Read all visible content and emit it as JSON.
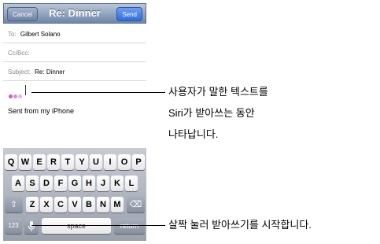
{
  "nav": {
    "cancel": "Cancel",
    "title": "Re: Dinner",
    "send": "Send"
  },
  "fields": {
    "to_label": "To:",
    "to_value": "Gilbert Solano",
    "cc_label": "Cc/Bcc:",
    "subject_label": "Subject:",
    "subject_value": "Re: Dinner"
  },
  "body": {
    "signature": "Sent from my iPhone"
  },
  "keyboard": {
    "row1": [
      "Q",
      "W",
      "E",
      "R",
      "T",
      "Y",
      "U",
      "I",
      "O",
      "P"
    ],
    "row2": [
      "A",
      "S",
      "D",
      "F",
      "G",
      "H",
      "J",
      "K",
      "L"
    ],
    "row3": [
      "Z",
      "X",
      "C",
      "V",
      "B",
      "N",
      "M"
    ],
    "shift": "⇧",
    "backspace": "⌫",
    "numbers": "123",
    "space": "space",
    "return": "return"
  },
  "callouts": {
    "dictation_line1": "사용자가 말한 텍스트를",
    "dictation_line2": "Siri가 받아쓰는 동안",
    "dictation_line3": "나타납니다.",
    "mic_tip": "살짝 눌러 받아쓰기를 시작합니다."
  },
  "colors": {
    "dictation_dots": "#c75cc9",
    "nav_bar": "#6f86a8",
    "send_button": "#2f6ee0"
  }
}
